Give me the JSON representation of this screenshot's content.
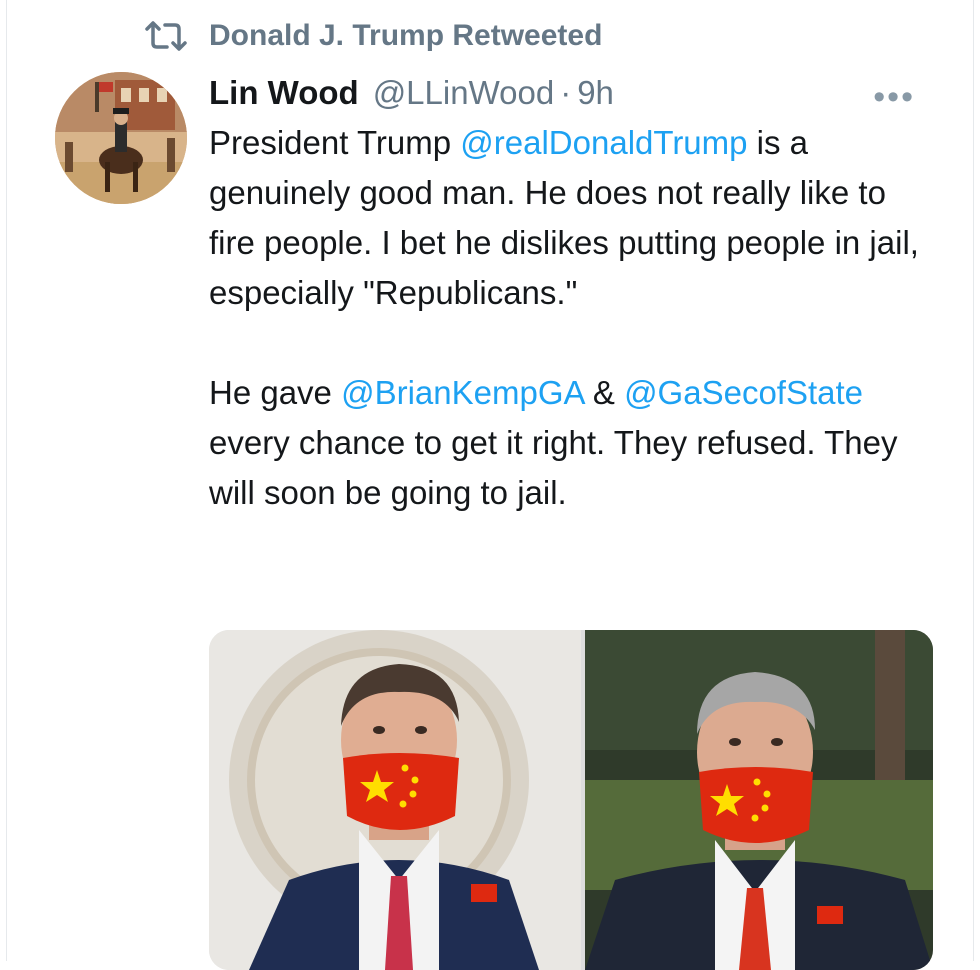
{
  "retweet": {
    "label": "Donald J. Trump Retweeted",
    "icon": "retweet-icon"
  },
  "tweet": {
    "author_name": "Lin Wood",
    "author_handle": "@LLinWood",
    "separator": "·",
    "time": "9h",
    "more": "•••",
    "paragraph1": {
      "t1": "President Trump ",
      "m1": "@realDonaldTrump",
      "t2": " is a genuinely good man. He does not really like to fire people. I bet he dislikes putting people in jail, especially \"Republicans.\""
    },
    "paragraph2": {
      "t1": "He gave ",
      "m1": "@BrianKempGA",
      "t2": " & ",
      "m2": "@GaSecofState",
      "t3": " every chance to get it right. They refused. They will soon be going to jail."
    }
  },
  "colors": {
    "mention": "#1da1f2",
    "secondary_text": "#657786",
    "primary_text": "#14171a"
  }
}
